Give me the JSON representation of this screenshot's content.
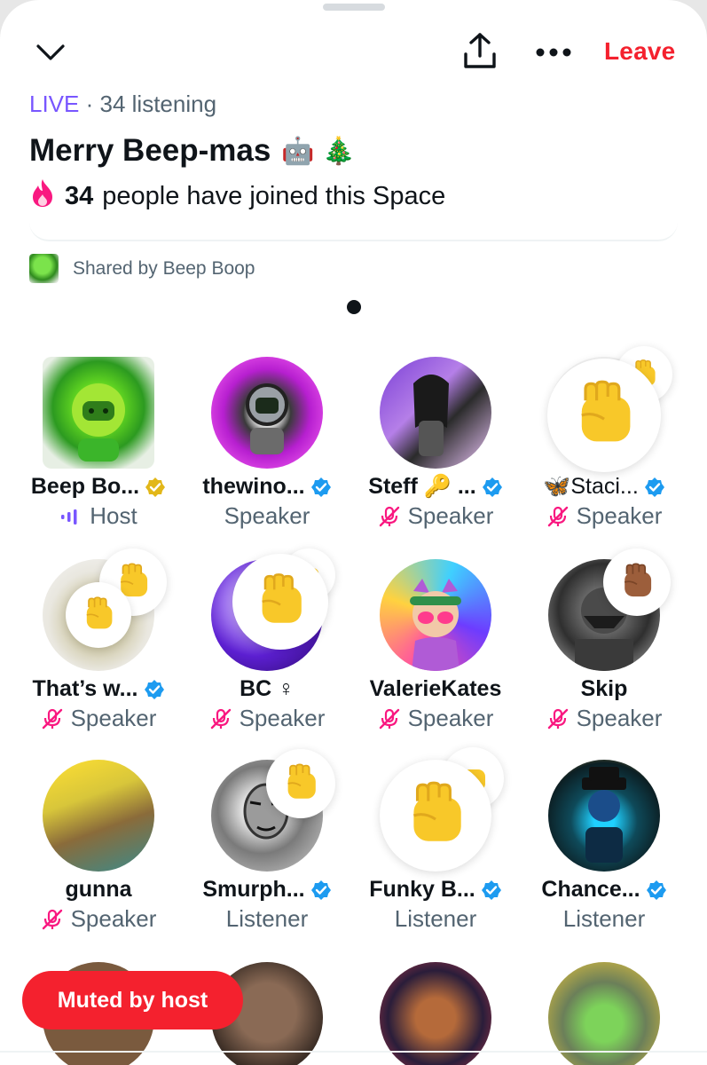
{
  "header": {
    "leave_label": "Leave"
  },
  "space": {
    "live_label": "LIVE",
    "separator": "·",
    "listening": "34 listening",
    "title": "Merry Beep-mas",
    "title_emojis": "🤖 🎄",
    "joined_count": "34",
    "joined_text": "people have joined this Space",
    "shared_by": "Shared by Beep Boop"
  },
  "participants": [
    {
      "name": "Beep Bo...",
      "role": "Host",
      "badge": "gold-check",
      "mic": "speaking"
    },
    {
      "name": "thewino...",
      "role": "Speaker",
      "badge": "blue-check",
      "mic": "none"
    },
    {
      "name": "Steff 🔑 ...",
      "role": "Speaker",
      "badge": "blue-check",
      "mic": "muted"
    },
    {
      "name": "🦋Staci...",
      "role": "Speaker",
      "badge": "blue-check",
      "mic": "muted"
    },
    {
      "name": "That’s w...",
      "role": "Speaker",
      "badge": "blue-check",
      "mic": "muted"
    },
    {
      "name": "BC ♀",
      "role": "Speaker",
      "badge": "none",
      "mic": "muted"
    },
    {
      "name": "ValerieKates",
      "role": "Speaker",
      "badge": "none",
      "mic": "muted"
    },
    {
      "name": "Skip",
      "role": "Speaker",
      "badge": "none",
      "mic": "muted"
    },
    {
      "name": "gunna",
      "role": "Speaker",
      "badge": "none",
      "mic": "muted"
    },
    {
      "name": "Smurph...",
      "role": "Listener",
      "badge": "blue-check",
      "mic": "none"
    },
    {
      "name": "Funky B...",
      "role": "Listener",
      "badge": "blue-check",
      "mic": "none"
    },
    {
      "name": "Chance...",
      "role": "Listener",
      "badge": "blue-check",
      "mic": "none"
    }
  ],
  "toast": {
    "label": "Muted by host"
  },
  "colors": {
    "accent_purple": "#7856ff",
    "leave_red": "#f4212e",
    "verified_blue": "#1d9bf0",
    "verified_gold": "#e2b719",
    "muted_pink": "#f91880",
    "secondary_text": "#536471"
  },
  "icons": [
    "chevron-down-icon",
    "share-icon",
    "more-icon",
    "fire-icon",
    "raised-fist-icon",
    "mic-off-icon",
    "speaking-bars-icon",
    "verified-badge-icon"
  ]
}
